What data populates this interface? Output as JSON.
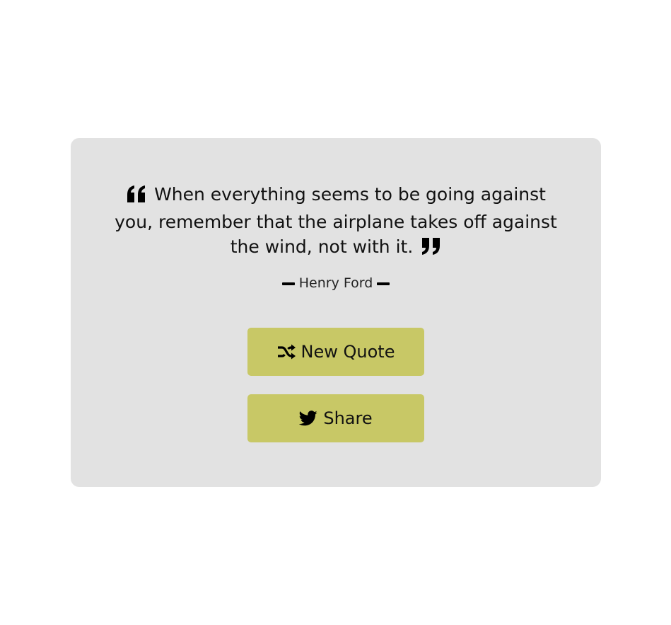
{
  "quote": {
    "text": "When everything seems to be going against you, remember that the airplane takes off against the wind, not with it.",
    "author": "Henry Ford"
  },
  "buttons": {
    "new_quote_label": "New Quote",
    "share_label": "Share"
  },
  "icons": {
    "quote_open": "quote-left-icon",
    "quote_close": "quote-right-icon",
    "new_quote": "shuffle-icon",
    "share": "twitter-icon"
  },
  "colors": {
    "card_background": "#e2e2e2",
    "button_background": "#c8c866",
    "text": "#111111"
  }
}
